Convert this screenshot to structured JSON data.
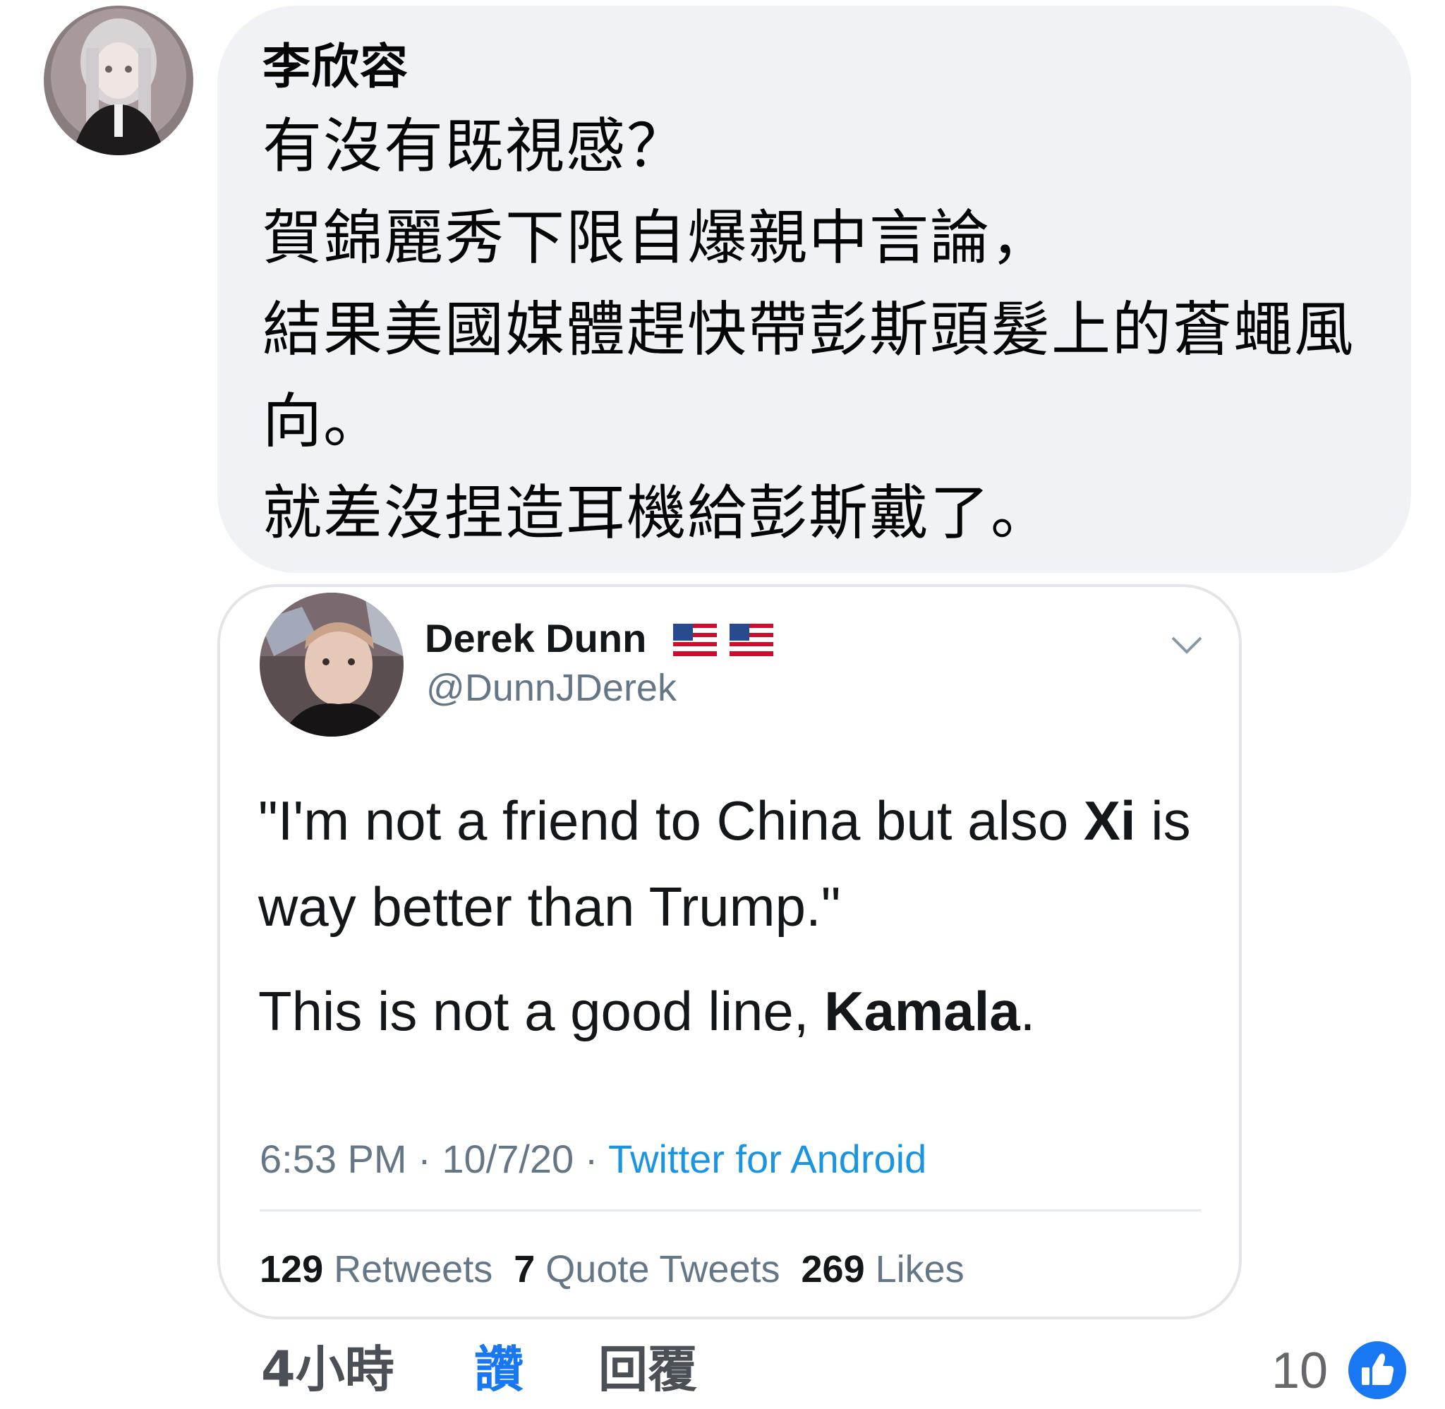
{
  "comment": {
    "author": "李欣容",
    "lines": [
      "有沒有既視感？",
      "賀錦麗秀下限自爆親中言論，",
      "結果美國媒體趕快帶彭斯頭髮上的蒼蠅風",
      "向。",
      "就差沒捏造耳機給彭斯戴了。"
    ]
  },
  "tweet": {
    "name": "Derek Dunn",
    "handle": "@DunnJDerek",
    "body1_a": "\"I'm not a friend to China but also ",
    "body1_bold": "Xi",
    "body1_b": " is way better than Trump.\"",
    "body2_a": "This is not a good line, ",
    "body2_bold": "Kamala",
    "body2_b": ".",
    "time": "6:53 PM",
    "date": "10/7/20",
    "source": "Twitter for Android",
    "retweets_count": "129",
    "retweets_label": "Retweets",
    "quotes_count": "7",
    "quotes_label": "Quote Tweets",
    "likes_count": "269",
    "likes_label": "Likes"
  },
  "actions": {
    "time": "4小時",
    "like": "讚",
    "reply": "回覆",
    "reaction_count": "10"
  },
  "icons": {
    "like_reaction": "thumbs-up-icon",
    "menu": "chevron-down-icon",
    "flag": "us-flag-icon"
  },
  "colors": {
    "bubble_bg": "#f0f2f5",
    "like_blue": "#1877f2",
    "twitter_link": "#1b95e0"
  }
}
